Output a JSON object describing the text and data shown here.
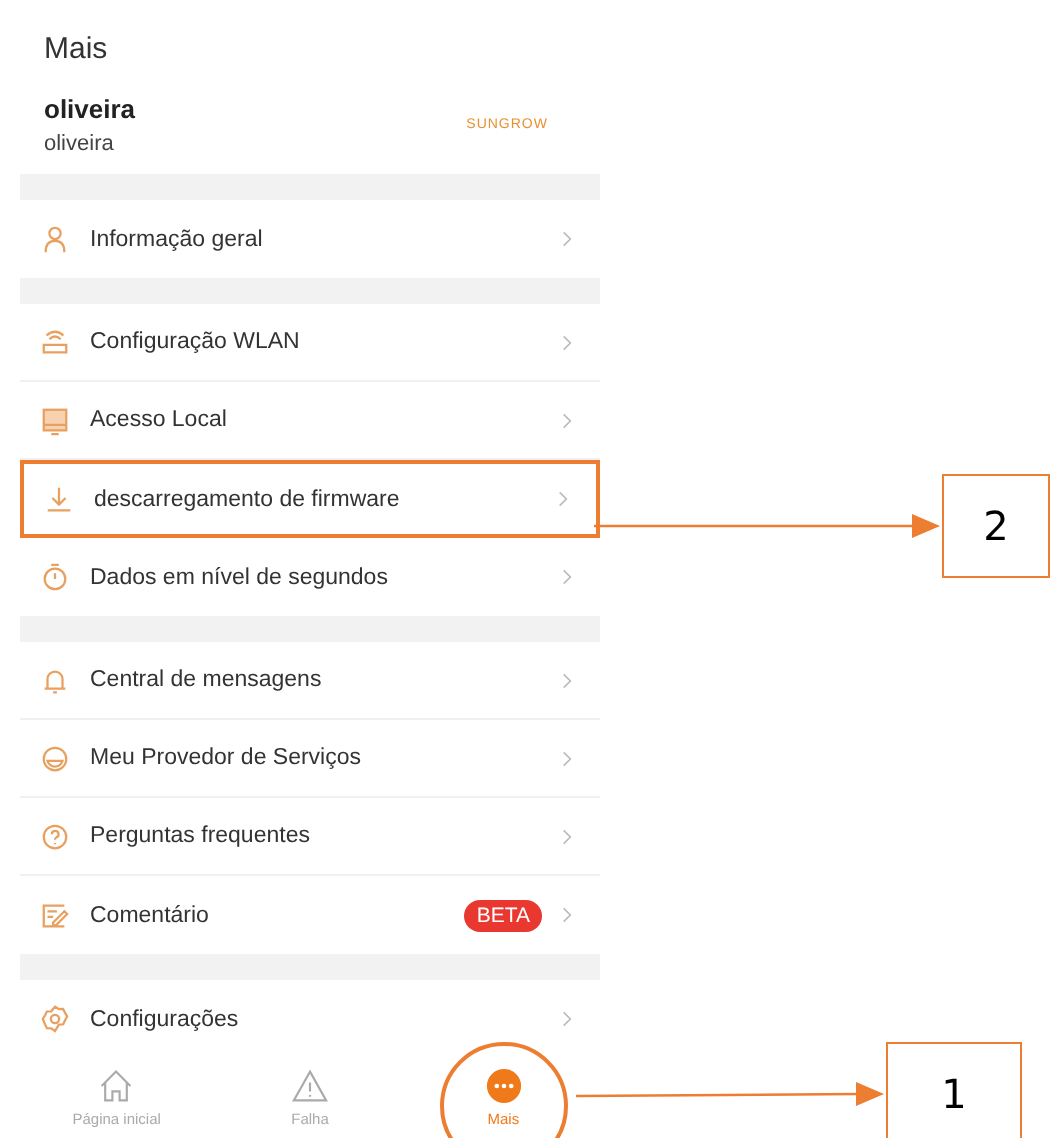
{
  "header": {
    "title": "Mais"
  },
  "profile": {
    "name": "oliveira",
    "subtitle": "oliveira",
    "logo": "SUNGROW"
  },
  "groups": [
    [
      {
        "kind": "person",
        "label": "Informação geral",
        "highlighted": false
      }
    ],
    [
      {
        "kind": "router",
        "label": "Configuração WLAN",
        "highlighted": false
      },
      {
        "kind": "screen",
        "label": "Acesso Local",
        "highlighted": false
      },
      {
        "kind": "download",
        "label": "descarregamento de firmware",
        "highlighted": true
      },
      {
        "kind": "timer",
        "label": "Dados em nível de segundos",
        "highlighted": false
      }
    ],
    [
      {
        "kind": "bell",
        "label": "Central de mensagens",
        "highlighted": false
      },
      {
        "kind": "service",
        "label": "Meu Provedor de Serviços",
        "highlighted": false
      },
      {
        "kind": "question",
        "label": "Perguntas frequentes",
        "highlighted": false
      },
      {
        "kind": "edit",
        "label": "Comentário",
        "badge": "BETA",
        "highlighted": false
      }
    ],
    [
      {
        "kind": "gear",
        "label": "Configurações",
        "highlighted": false
      }
    ]
  ],
  "tabs": [
    {
      "kind": "home",
      "label": "Página inicial",
      "selected": false,
      "circled": false
    },
    {
      "kind": "warning",
      "label": "Falha",
      "selected": false,
      "circled": false
    },
    {
      "kind": "more",
      "label": "Mais",
      "selected": true,
      "circled": true
    }
  ],
  "annotations": [
    {
      "label": "2"
    },
    {
      "label": "1"
    }
  ]
}
